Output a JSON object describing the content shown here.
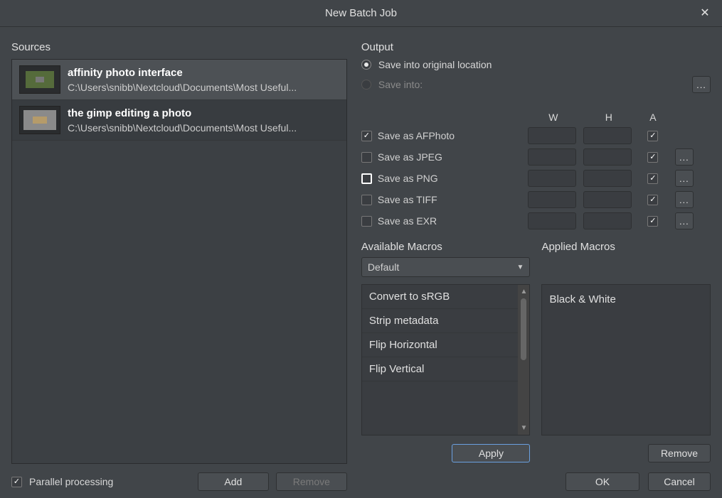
{
  "title": "New Batch Job",
  "sources_label": "Sources",
  "sources": [
    {
      "name": "affinity photo interface",
      "path": "C:\\Users\\snibb\\Nextcloud\\Documents\\Most Useful..."
    },
    {
      "name": "the gimp editing a photo",
      "path": "C:\\Users\\snibb\\Nextcloud\\Documents\\Most Useful..."
    }
  ],
  "parallel_label": "Parallel processing",
  "parallel_checked": true,
  "add_btn": "Add",
  "remove_btn": "Remove",
  "output_label": "Output",
  "save_orig_label": "Save into original location",
  "save_into_label": "Save into:",
  "save_into_more": "...",
  "col_w": "W",
  "col_h": "H",
  "col_a": "A",
  "formats": [
    {
      "label": "Save as AFPhoto",
      "checked": true,
      "a": true,
      "more": false
    },
    {
      "label": "Save as JPEG",
      "checked": false,
      "a": true,
      "more": true
    },
    {
      "label": "Save as PNG",
      "checked": false,
      "a": true,
      "more": true
    },
    {
      "label": "Save as TIFF",
      "checked": false,
      "a": true,
      "more": true
    },
    {
      "label": "Save as EXR",
      "checked": false,
      "a": true,
      "more": true
    }
  ],
  "avail_label": "Available Macros",
  "applied_label": "Applied Macros",
  "macro_select": "Default",
  "available_macros": [
    "Convert to sRGB",
    "Strip metadata",
    "Flip Horizontal",
    "Flip Vertical"
  ],
  "applied_macros": [
    "Black & White"
  ],
  "apply_btn": "Apply",
  "remove_macro_btn": "Remove",
  "ok_btn": "OK",
  "cancel_btn": "Cancel",
  "more": "..."
}
